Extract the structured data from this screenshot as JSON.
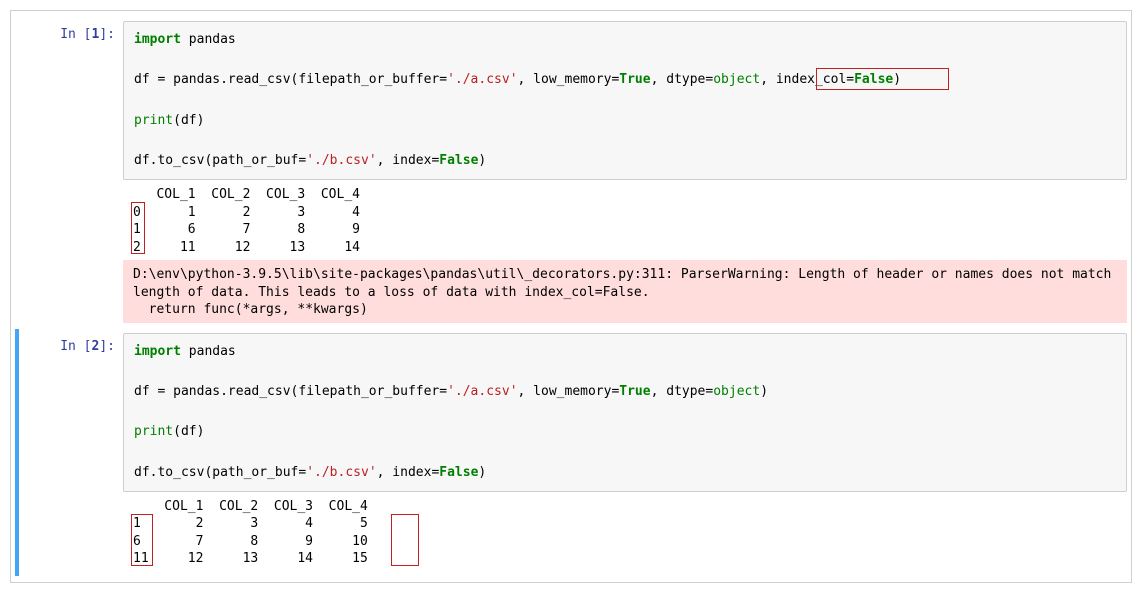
{
  "cells": {
    "0": {
      "prompt_prefix": "In [",
      "prompt_num": "1",
      "prompt_suffix": "]:",
      "code": {
        "l1_kw_import": "import",
        "l1_mod": " pandas",
        "l3_a": "df ",
        "l3_eq": "=",
        "l3_b": " pandas.read_csv(filepath_or_buffer",
        "l3_eq2": "=",
        "l3_str1": "'./a.csv'",
        "l3_c": ", low_memory",
        "l3_eq3": "=",
        "l3_true": "True",
        "l3_d": ", dtype",
        "l3_eq4": "=",
        "l3_obj": "object",
        "l3_e": ", index_col",
        "l3_eq5": "=",
        "l3_false": "False",
        "l3_close": ")",
        "l5_print": "print",
        "l5_rest": "(df)",
        "l7_a": "df.to_csv(path_or_buf",
        "l7_eq": "=",
        "l7_str": "'./b.csv'",
        "l7_b": ", index",
        "l7_eq2": "=",
        "l7_false": "False",
        "l7_close": ")"
      },
      "stdout": "   COL_1  COL_2  COL_3  COL_4\n0      1      2      3      4\n1      6      7      8      9\n2     11     12     13     14",
      "stderr": "D:\\env\\python-3.9.5\\lib\\site-packages\\pandas\\util\\_decorators.py:311: ParserWarning: Length of header or names does not match length of data. This leads to a loss of data with index_col=False.\n  return func(*args, **kwargs)"
    },
    "1": {
      "prompt_prefix": "In [",
      "prompt_num": "2",
      "prompt_suffix": "]:",
      "code": {
        "l1_kw_import": "import",
        "l1_mod": " pandas",
        "l3_a": "df ",
        "l3_eq": "=",
        "l3_b": " pandas.read_csv(filepath_or_buffer",
        "l3_eq2": "=",
        "l3_str1": "'./a.csv'",
        "l3_c": ", low_memory",
        "l3_eq3": "=",
        "l3_true": "True",
        "l3_d": ", dtype",
        "l3_eq4": "=",
        "l3_obj": "object",
        "l3_close": ")",
        "l5_print": "print",
        "l5_rest": "(df)",
        "l7_a": "df.to_csv(path_or_buf",
        "l7_eq": "=",
        "l7_str": "'./b.csv'",
        "l7_b": ", index",
        "l7_eq2": "=",
        "l7_false": "False",
        "l7_close": ")"
      },
      "stdout": "    COL_1  COL_2  COL_3  COL_4\n1       2      3      4      5\n6       7      8      9     10\n11     12     13     14     15"
    }
  }
}
